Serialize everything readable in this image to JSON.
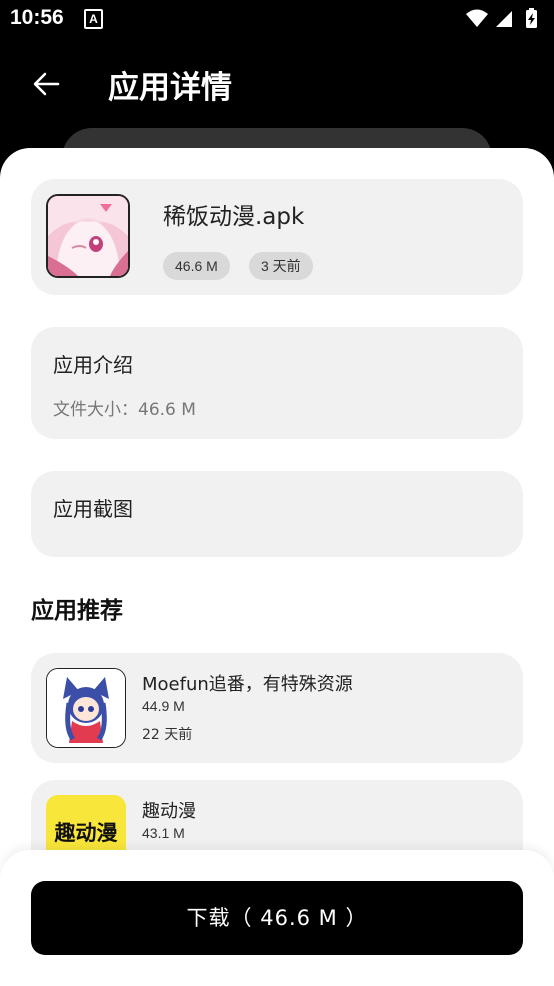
{
  "status_bar": {
    "time": "10:56",
    "notification_icon": "A"
  },
  "header": {
    "title": "应用详情"
  },
  "app": {
    "name": "稀饭动漫.apk",
    "size_chip": "46.6 M",
    "time_chip": "3 天前"
  },
  "intro": {
    "title": "应用介绍",
    "file_size": "文件大小：46.6 M"
  },
  "screenshots": {
    "title": "应用截图"
  },
  "recommend": {
    "title": "应用推荐",
    "items": [
      {
        "name": "Moefun追番，有特殊资源",
        "size": "44.9 M",
        "time": "22 天前"
      },
      {
        "name": "趣动漫",
        "size": "43.1 M",
        "icon_text": "趣动漫"
      }
    ]
  },
  "download": {
    "label": "下载（ 46.6 M ）"
  },
  "colors": {
    "accent": "#000000",
    "card": "#f1f1f1",
    "chip": "#d9d9d9",
    "icon_yellow": "#f9e63a"
  }
}
